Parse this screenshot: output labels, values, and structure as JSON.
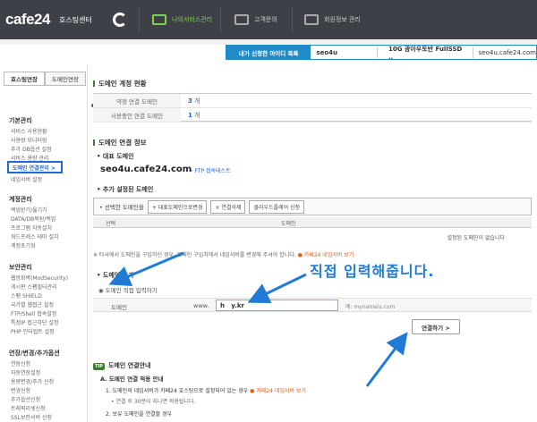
{
  "header": {
    "logo": "cafe24",
    "subtitle": "호스팅센터",
    "nav": [
      {
        "label": "나의서비스관리",
        "icon": "service-icon"
      },
      {
        "label": "고객문의",
        "icon": "support-icon"
      },
      {
        "label": "회원정보 관리",
        "icon": "member-icon"
      }
    ]
  },
  "idbar": {
    "label": "내가 신청한 아이디 목록",
    "user_id": "seo4u",
    "plan": "10G 광아우토반 FullSSD ..",
    "domain": "seo4u.cafe24.com"
  },
  "sidebar": {
    "tabs": [
      "호스팅연장",
      "도메인연장"
    ],
    "section_main": "호스팅관리",
    "groups": [
      {
        "title": "기본관리",
        "items": [
          "서비스 사용현황",
          "사용량 모니터링",
          "추가 DB옵션 설정",
          "서비스 용량 관리",
          "도메인 연결관리 >",
          "네임서버 설정"
        ]
      },
      {
        "title": "계정관리",
        "items": [
          "백업받기/옮기기",
          "DATA/DB복원/백업",
          "프로그램 자동설치",
          "워드프레스 테마 설치",
          "계정초기화"
        ]
      },
      {
        "title": "보안관리",
        "items": [
          "웹방화벽(ModSecurity)",
          "게시판 스팸필터관리",
          "스팸 SHIELD",
          "국가별 웹접근 설정",
          "FTP/Shell 접속설정",
          "특정IP 접근차단 설정",
          "PHP 인터럽트 설정"
        ]
      },
      {
        "title": "연장/변경/추가옵션",
        "items": [
          "연장신청",
          "자동연장설정",
          "용량변경/추가 신청",
          "변경신청",
          "추가옵션신청",
          "트래픽리셋신청",
          "SSL보안서버 신청"
        ]
      }
    ]
  },
  "status": {
    "title": "도메인 계정 현황",
    "rows": [
      {
        "label": "약정 연결 도메인",
        "value": "3",
        "unit": "개"
      },
      {
        "label": "사용중인 연결 도메인",
        "value": "1",
        "unit": "개"
      }
    ]
  },
  "connect_info": {
    "title": "도메인 연결 정보",
    "rep_label": "• 대표 도메인",
    "rep_domain": "seo4u.cafe24.com",
    "ftp_link": "• FTP 접속테스트",
    "extra_label": "• 추가 설정된 도메인",
    "toolbar_label": "• 선택한 도메인을",
    "toolbar_buttons": [
      "+ 대표도메인으로변경",
      "× 연결삭제",
      "클라우드플레어 신청"
    ],
    "col_select": "선택",
    "col_domain": "도메인",
    "empty_text": "설정된 도메인이 없습니다",
    "notice_text": "※ 타사에서 도메인을 구입하신 경우, 도메인 구입처에서 네임서버를 변경해 주셔야 합니다.",
    "notice_link": "카페24 네임서버 보기"
  },
  "add_domain": {
    "label": "• 도메인 추가",
    "radio_label": "도메인 직접 입력하기",
    "field_label": "도메인",
    "prefix": "www.",
    "value": "h   y.kr",
    "example": "예: mynameis.com",
    "button": "연결하기 >"
  },
  "guide": {
    "badge": "TIP",
    "title": "도메인 연결안내",
    "sub_a": "A. 도메인 연결 적용 안내",
    "line1": "1. 도메인의 네임서버가 카페24 호스팅으로 설정되어 있는 경우",
    "line1_link": "카페24 네임서버 보기",
    "line1b": "• 연결 후 30분이 지나면 적용됩니다.",
    "line2": "2. 보유 도메인을 연결할 경우"
  },
  "callout": "직접 입력해줍니다.",
  "colors": {
    "accent": "#1f7bd6",
    "green": "#3a7d2c",
    "topbar": "#3d4147"
  }
}
